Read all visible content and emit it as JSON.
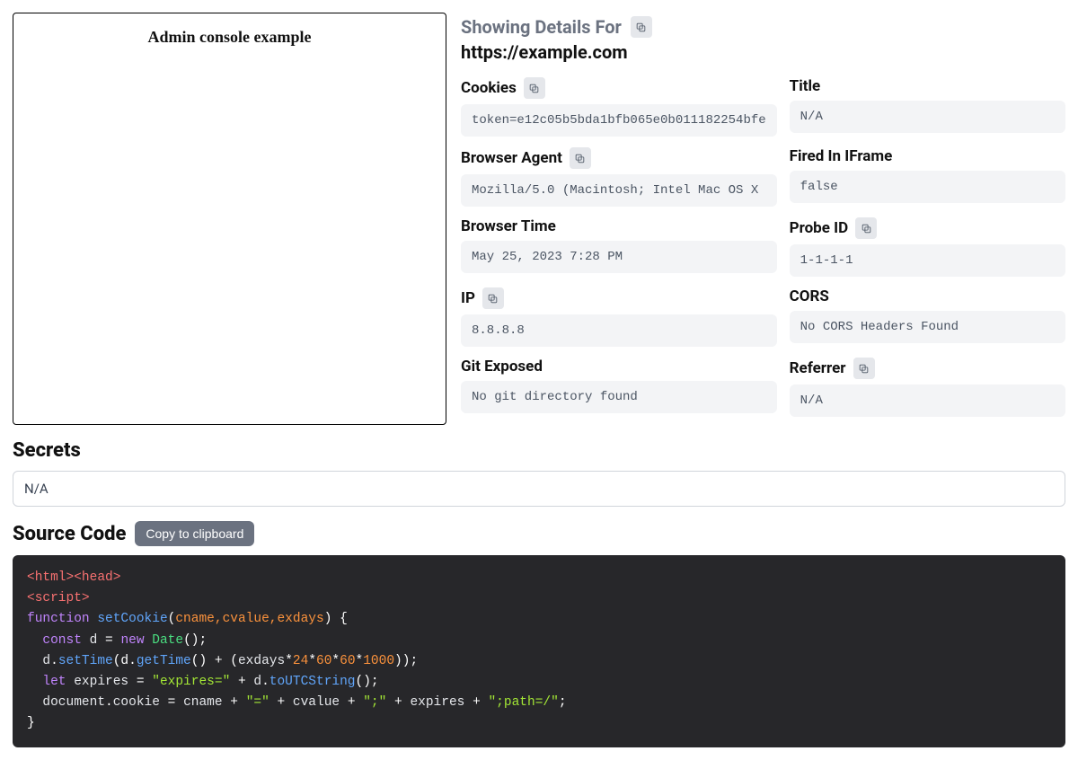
{
  "preview": {
    "title": "Admin console example"
  },
  "header": {
    "showing_label": "Showing Details For",
    "url": "https://example.com"
  },
  "fields": {
    "cookies": {
      "label": "Cookies",
      "value": "token=e12c05b5bda1bfb065e0b011182254bfe"
    },
    "title_f": {
      "label": "Title",
      "value": "N/A"
    },
    "agent": {
      "label": "Browser Agent",
      "value": "Mozilla/5.0 (Macintosh; Intel Mac OS X"
    },
    "iframe": {
      "label": "Fired In IFrame",
      "value": "false"
    },
    "time": {
      "label": "Browser Time",
      "value": "May 25, 2023 7:28 PM"
    },
    "probe": {
      "label": "Probe ID",
      "value": "1-1-1-1"
    },
    "ip": {
      "label": "IP",
      "value": "8.8.8.8"
    },
    "cors": {
      "label": "CORS",
      "value": "No CORS Headers Found"
    },
    "git": {
      "label": "Git Exposed",
      "value": "No git directory found"
    },
    "referrer": {
      "label": "Referrer",
      "value": "N/A"
    }
  },
  "secrets": {
    "title": "Secrets",
    "value": "N/A"
  },
  "source": {
    "title": "Source Code",
    "copy_label": "Copy to clipboard"
  },
  "code": {
    "l1_a": "<html><head>",
    "l2_a": "<script>",
    "l3_kw1": "function",
    "l3_fn": "setCookie",
    "l3_p": "cname,cvalue,exdays",
    "l4_kw": "const",
    "l4_v": "d",
    "l4_kw2": "new",
    "l4_cls": "Date",
    "l5_v": "d",
    "l5_fn1": "setTime",
    "l5_fn2": "getTime",
    "l5_p": "exdays",
    "l5_n1": "24",
    "l5_n2": "60",
    "l5_n3": "60",
    "l5_n4": "1000",
    "l6_kw": "let",
    "l6_v": "expires",
    "l6_s": "\"expires=\"",
    "l6_v2": "d",
    "l6_fn": "toUTCString",
    "l7_obj": "document",
    "l7_prop": "cookie",
    "l7_v1": "cname",
    "l7_s1": "\"=\"",
    "l7_v2": "cvalue",
    "l7_s2": "\";\"",
    "l7_v3": "expires",
    "l7_s3": "\";path=/\""
  }
}
